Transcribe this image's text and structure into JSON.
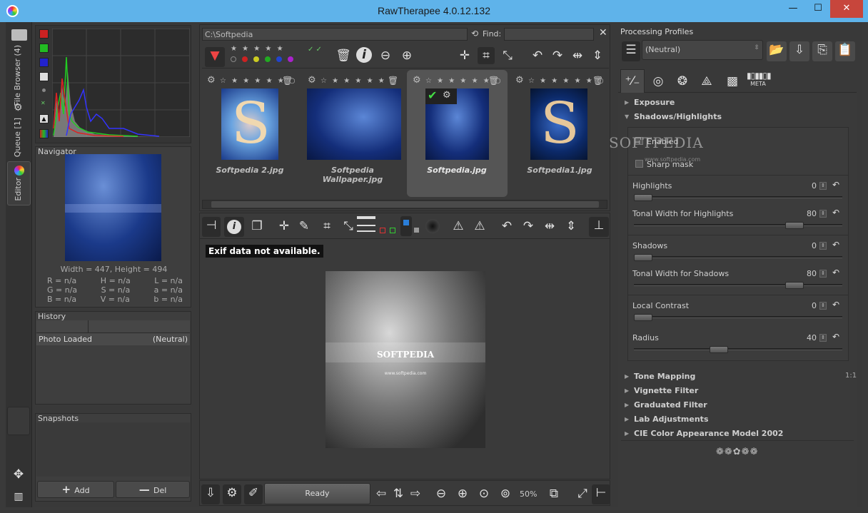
{
  "window": {
    "title": "RawTherapee 4.0.12.132",
    "min": "—",
    "max": "☐",
    "close": "✕"
  },
  "vtabs": {
    "file_browser": "File Browser (4)",
    "queue": "Queue [1]",
    "editor": "Editor"
  },
  "navigator": {
    "title": "Navigator",
    "dims": "Width = 447, Height = 494",
    "values": [
      [
        "R = n/a",
        "H = n/a",
        "L = n/a"
      ],
      [
        "G = n/a",
        "S = n/a",
        "a = n/a"
      ],
      [
        "B = n/a",
        "V = n/a",
        "b = n/a"
      ]
    ]
  },
  "history": {
    "title": "History",
    "rows": [
      {
        "label": "Photo Loaded",
        "value": "(Neutral)"
      }
    ]
  },
  "snapshots": {
    "title": "Snapshots",
    "add": "Add",
    "del": "Del"
  },
  "browser": {
    "path": "C:\\Softpedia",
    "find_label": "Find:",
    "find_value": "",
    "thumbs": [
      {
        "name": "Softpedia 2.jpg",
        "selected": false
      },
      {
        "name": "Softpedia Wallpaper.jpg",
        "selected": false
      },
      {
        "name": "Softpedia.jpg",
        "selected": true
      },
      {
        "name": "Softpedia1.jpg",
        "selected": false
      }
    ]
  },
  "editor": {
    "exif": "Exif data not available.",
    "image_caption": "SOFTPEDIA",
    "image_url": "www.softpedia.com",
    "status": "Ready",
    "zoom": "50%"
  },
  "profiles": {
    "title": "Processing Profiles",
    "current": "(Neutral)",
    "tab_meta": "META"
  },
  "tools": {
    "exposure": "Exposure",
    "shadows_highlights": "Shadows/Highlights",
    "enabled": "Enabled",
    "sharp_mask": "Sharp mask",
    "sliders": [
      {
        "label": "Highlights",
        "value": "0",
        "pos": 0
      },
      {
        "label": "Tonal Width for Highlights",
        "value": "80",
        "pos": 80
      },
      {
        "label": "Shadows",
        "value": "0",
        "pos": 0
      },
      {
        "label": "Tonal Width for Shadows",
        "value": "80",
        "pos": 80
      },
      {
        "label": "Local Contrast",
        "value": "0",
        "pos": 0
      },
      {
        "label": "Radius",
        "value": "40",
        "pos": 40
      }
    ],
    "collapsed": [
      "Tone Mapping",
      "Vignette Filter",
      "Graduated Filter",
      "Lab Adjustments",
      "CIE Color Appearance Model 2002"
    ],
    "ratio": "1:1"
  },
  "watermark": "SOFTPEDIA",
  "watermark_sub": "www.softpedia.com",
  "colors": {
    "titlebar": "#5fb3ea",
    "close": "#c7463c",
    "bg": "#393939"
  }
}
